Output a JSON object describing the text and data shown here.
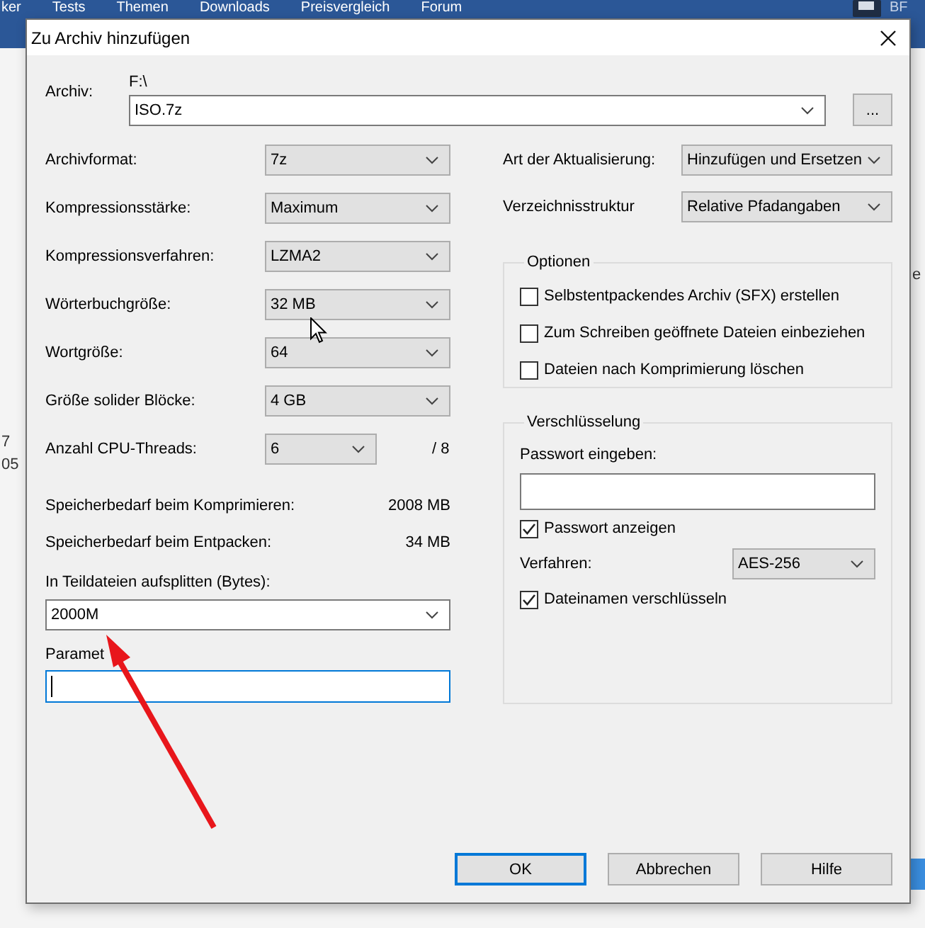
{
  "background_page": {
    "nav_items": [
      "ker",
      "Tests",
      "Themen",
      "Downloads",
      "Preisvergleich",
      "Forum"
    ],
    "user_label": "BF",
    "left_fragments": [
      "7",
      "05"
    ],
    "right_fragments": [
      "e"
    ]
  },
  "dialog": {
    "title": "Zu Archiv hinzufügen"
  },
  "archive": {
    "label": "Archiv:",
    "path": "F:\\",
    "value": "ISO.7z",
    "browse_button": "..."
  },
  "left_settings": [
    {
      "label": "Archivformat:",
      "value": "7z"
    },
    {
      "label": "Kompressionsstärke:",
      "value": "Maximum"
    },
    {
      "label": "Kompressionsverfahren:",
      "value": "LZMA2"
    },
    {
      "label": "Wörterbuchgröße:",
      "value": "32 MB"
    },
    {
      "label": "Wortgröße:",
      "value": "64"
    },
    {
      "label": "Größe solider Blöcke:",
      "value": "4 GB"
    },
    {
      "label": "Anzahl CPU-Threads:",
      "value": "6",
      "suffix": "/ 8"
    }
  ],
  "memory": [
    {
      "label": "Speicherbedarf beim Komprimieren:",
      "value": "2008 MB"
    },
    {
      "label": "Speicherbedarf beim Entpacken:",
      "value": "34 MB"
    }
  ],
  "split": {
    "label": "In Teildateien aufsplitten (Bytes):",
    "value": "2000M"
  },
  "parameters": {
    "label": "Paramet",
    "focused": true
  },
  "right_settings": [
    {
      "label": "Art der Aktualisierung:",
      "value": "Hinzufügen und Ersetzen"
    },
    {
      "label": "Verzeichnisstruktur",
      "value": "Relative Pfadangaben"
    }
  ],
  "options": {
    "title": "Optionen",
    "items": [
      {
        "label": "Selbstentpackendes Archiv (SFX) erstellen",
        "checked": false
      },
      {
        "label": "Zum Schreiben geöffnete Dateien einbeziehen",
        "checked": false
      },
      {
        "label": "Dateien nach Komprimierung löschen",
        "checked": false
      }
    ]
  },
  "encryption": {
    "title": "Verschlüsselung",
    "password_label": "Passwort eingeben:",
    "show_password": {
      "label": "Passwort anzeigen",
      "checked": true
    },
    "method_label": "Verfahren:",
    "method": "AES-256",
    "encrypt_names": {
      "label": "Dateinamen verschlüsseln",
      "checked": true
    }
  },
  "buttons": [
    {
      "label": "OK",
      "default": true
    },
    {
      "label": "Abbrechen",
      "default": false
    },
    {
      "label": "Hilfe",
      "default": false
    }
  ]
}
